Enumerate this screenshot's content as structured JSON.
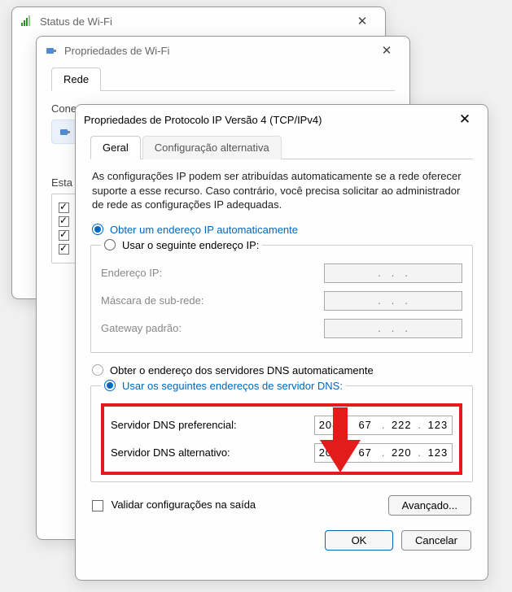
{
  "status_window": {
    "title": "Status de Wi-Fi"
  },
  "wifi_window": {
    "title": "Propriedades de Wi-Fi",
    "tabs": {
      "rede": "Rede"
    },
    "connect_label": "Conectar usando:",
    "items_label": "Esta conexão usa os seguintes itens:",
    "checks": [
      "",
      "",
      "",
      ""
    ]
  },
  "ipv4": {
    "title": "Propriedades de Protocolo IP Versão 4 (TCP/IPv4)",
    "tabs": {
      "general": "Geral",
      "alt": "Configuração alternativa"
    },
    "description": "As configurações IP podem ser atribuídas automaticamente se a rede oferecer suporte a esse recurso. Caso contrário, você precisa solicitar ao administrador de rede as configurações IP adequadas.",
    "ip_auto_label": "Obter um endereço IP automaticamente",
    "ip_manual_label": "Usar o seguinte endereço IP:",
    "ip_fields": {
      "address": "Endereço IP:",
      "mask": "Máscara de sub-rede:",
      "gateway": "Gateway padrão:"
    },
    "dns_auto_label": "Obter o endereço dos servidores DNS automaticamente",
    "dns_manual_label": "Usar os seguintes endereços de servidor DNS:",
    "dns_fields": {
      "pref": "Servidor DNS preferencial:",
      "alt": "Servidor DNS alternativo:"
    },
    "dns_values": {
      "pref": [
        "208",
        "67",
        "222",
        "123"
      ],
      "alt": [
        "208",
        "67",
        "220",
        "123"
      ]
    },
    "validate_label": "Validar configurações na saída",
    "advanced_label": "Avançado...",
    "ok_label": "OK",
    "cancel_label": "Cancelar"
  }
}
